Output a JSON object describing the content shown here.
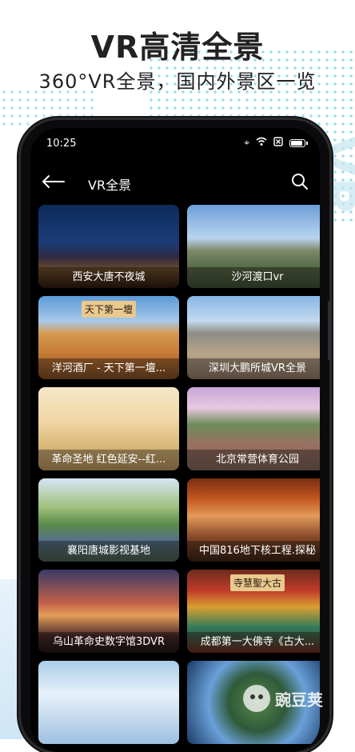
{
  "promo": {
    "headline": "VR高清全景",
    "subline": "360°VR全景，国内外景区一览"
  },
  "status_bar": {
    "time": "10:25",
    "icons": [
      "location-icon",
      "wifi-icon",
      "sim-icon",
      "battery-icon"
    ]
  },
  "app_bar": {
    "title": "VR全景",
    "back_icon": "back-arrow-icon",
    "search_icon": "search-icon"
  },
  "cards": [
    {
      "label": "西安大唐不夜城"
    },
    {
      "label": "沙河渡口vr"
    },
    {
      "label": "洋河酒厂 - 天下第一壇..."
    },
    {
      "label": "深圳大鹏所城VR全景"
    },
    {
      "label": "革命圣地 红色延安--红..."
    },
    {
      "label": "北京常营体育公园"
    },
    {
      "label": "襄阳唐城影视基地"
    },
    {
      "label": "中国816地下核工程.探秘"
    },
    {
      "label": "乌山革命史数字馆3DVR"
    },
    {
      "label": "成都第一大佛寺《古大..."
    },
    {
      "label": ""
    },
    {
      "label": ""
    }
  ],
  "card_texts": {
    "c3_sign": "天下第一壇",
    "c10_sign": "寺慧聖大古"
  },
  "watermark": {
    "logo_text": "豌豆荚"
  }
}
